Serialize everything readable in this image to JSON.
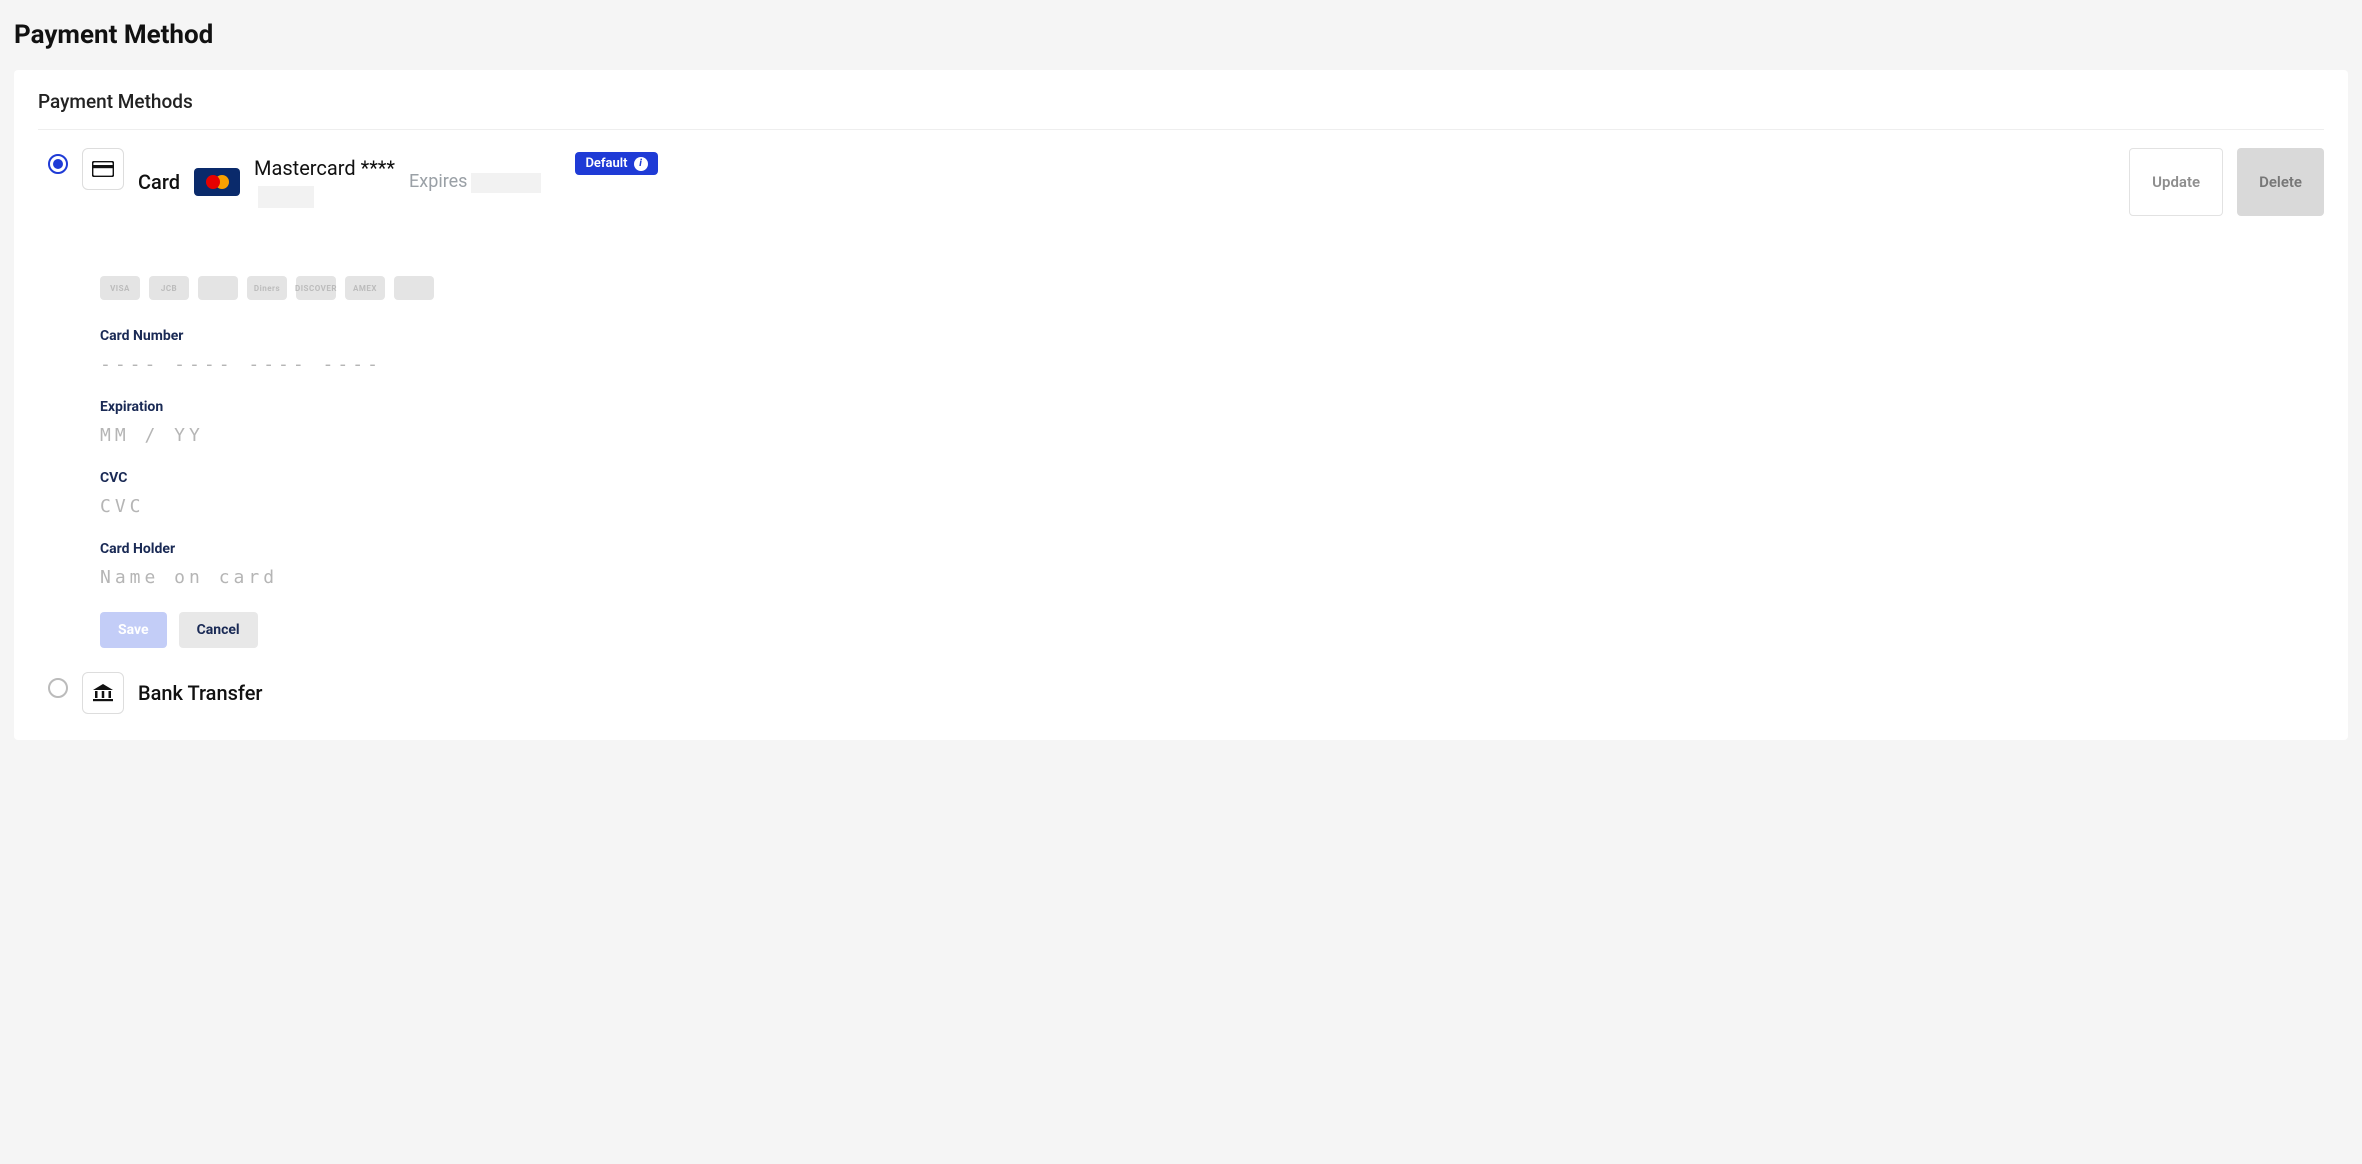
{
  "pageTitle": "Payment Method",
  "sectionTitle": "Payment Methods",
  "methods": {
    "card": {
      "label": "Card",
      "brand": "Mastercard",
      "summary": "Mastercard ****",
      "expiresLabel": "Expires",
      "defaultBadge": "Default",
      "updateLabel": "Update",
      "deleteLabel": "Delete"
    },
    "bank": {
      "label": "Bank Transfer"
    }
  },
  "brandIcons": [
    "VISA",
    "JCB",
    "",
    "Diners",
    "DISCOVER",
    "AMEX",
    ""
  ],
  "form": {
    "cardNumber": {
      "label": "Card Number",
      "placeholder": "---- ---- ---- ----"
    },
    "expiration": {
      "label": "Expiration",
      "placeholder": "MM / YY"
    },
    "cvc": {
      "label": "CVC",
      "placeholder": "CVC"
    },
    "holder": {
      "label": "Card Holder",
      "placeholder": "Name on card"
    },
    "save": "Save",
    "cancel": "Cancel"
  }
}
